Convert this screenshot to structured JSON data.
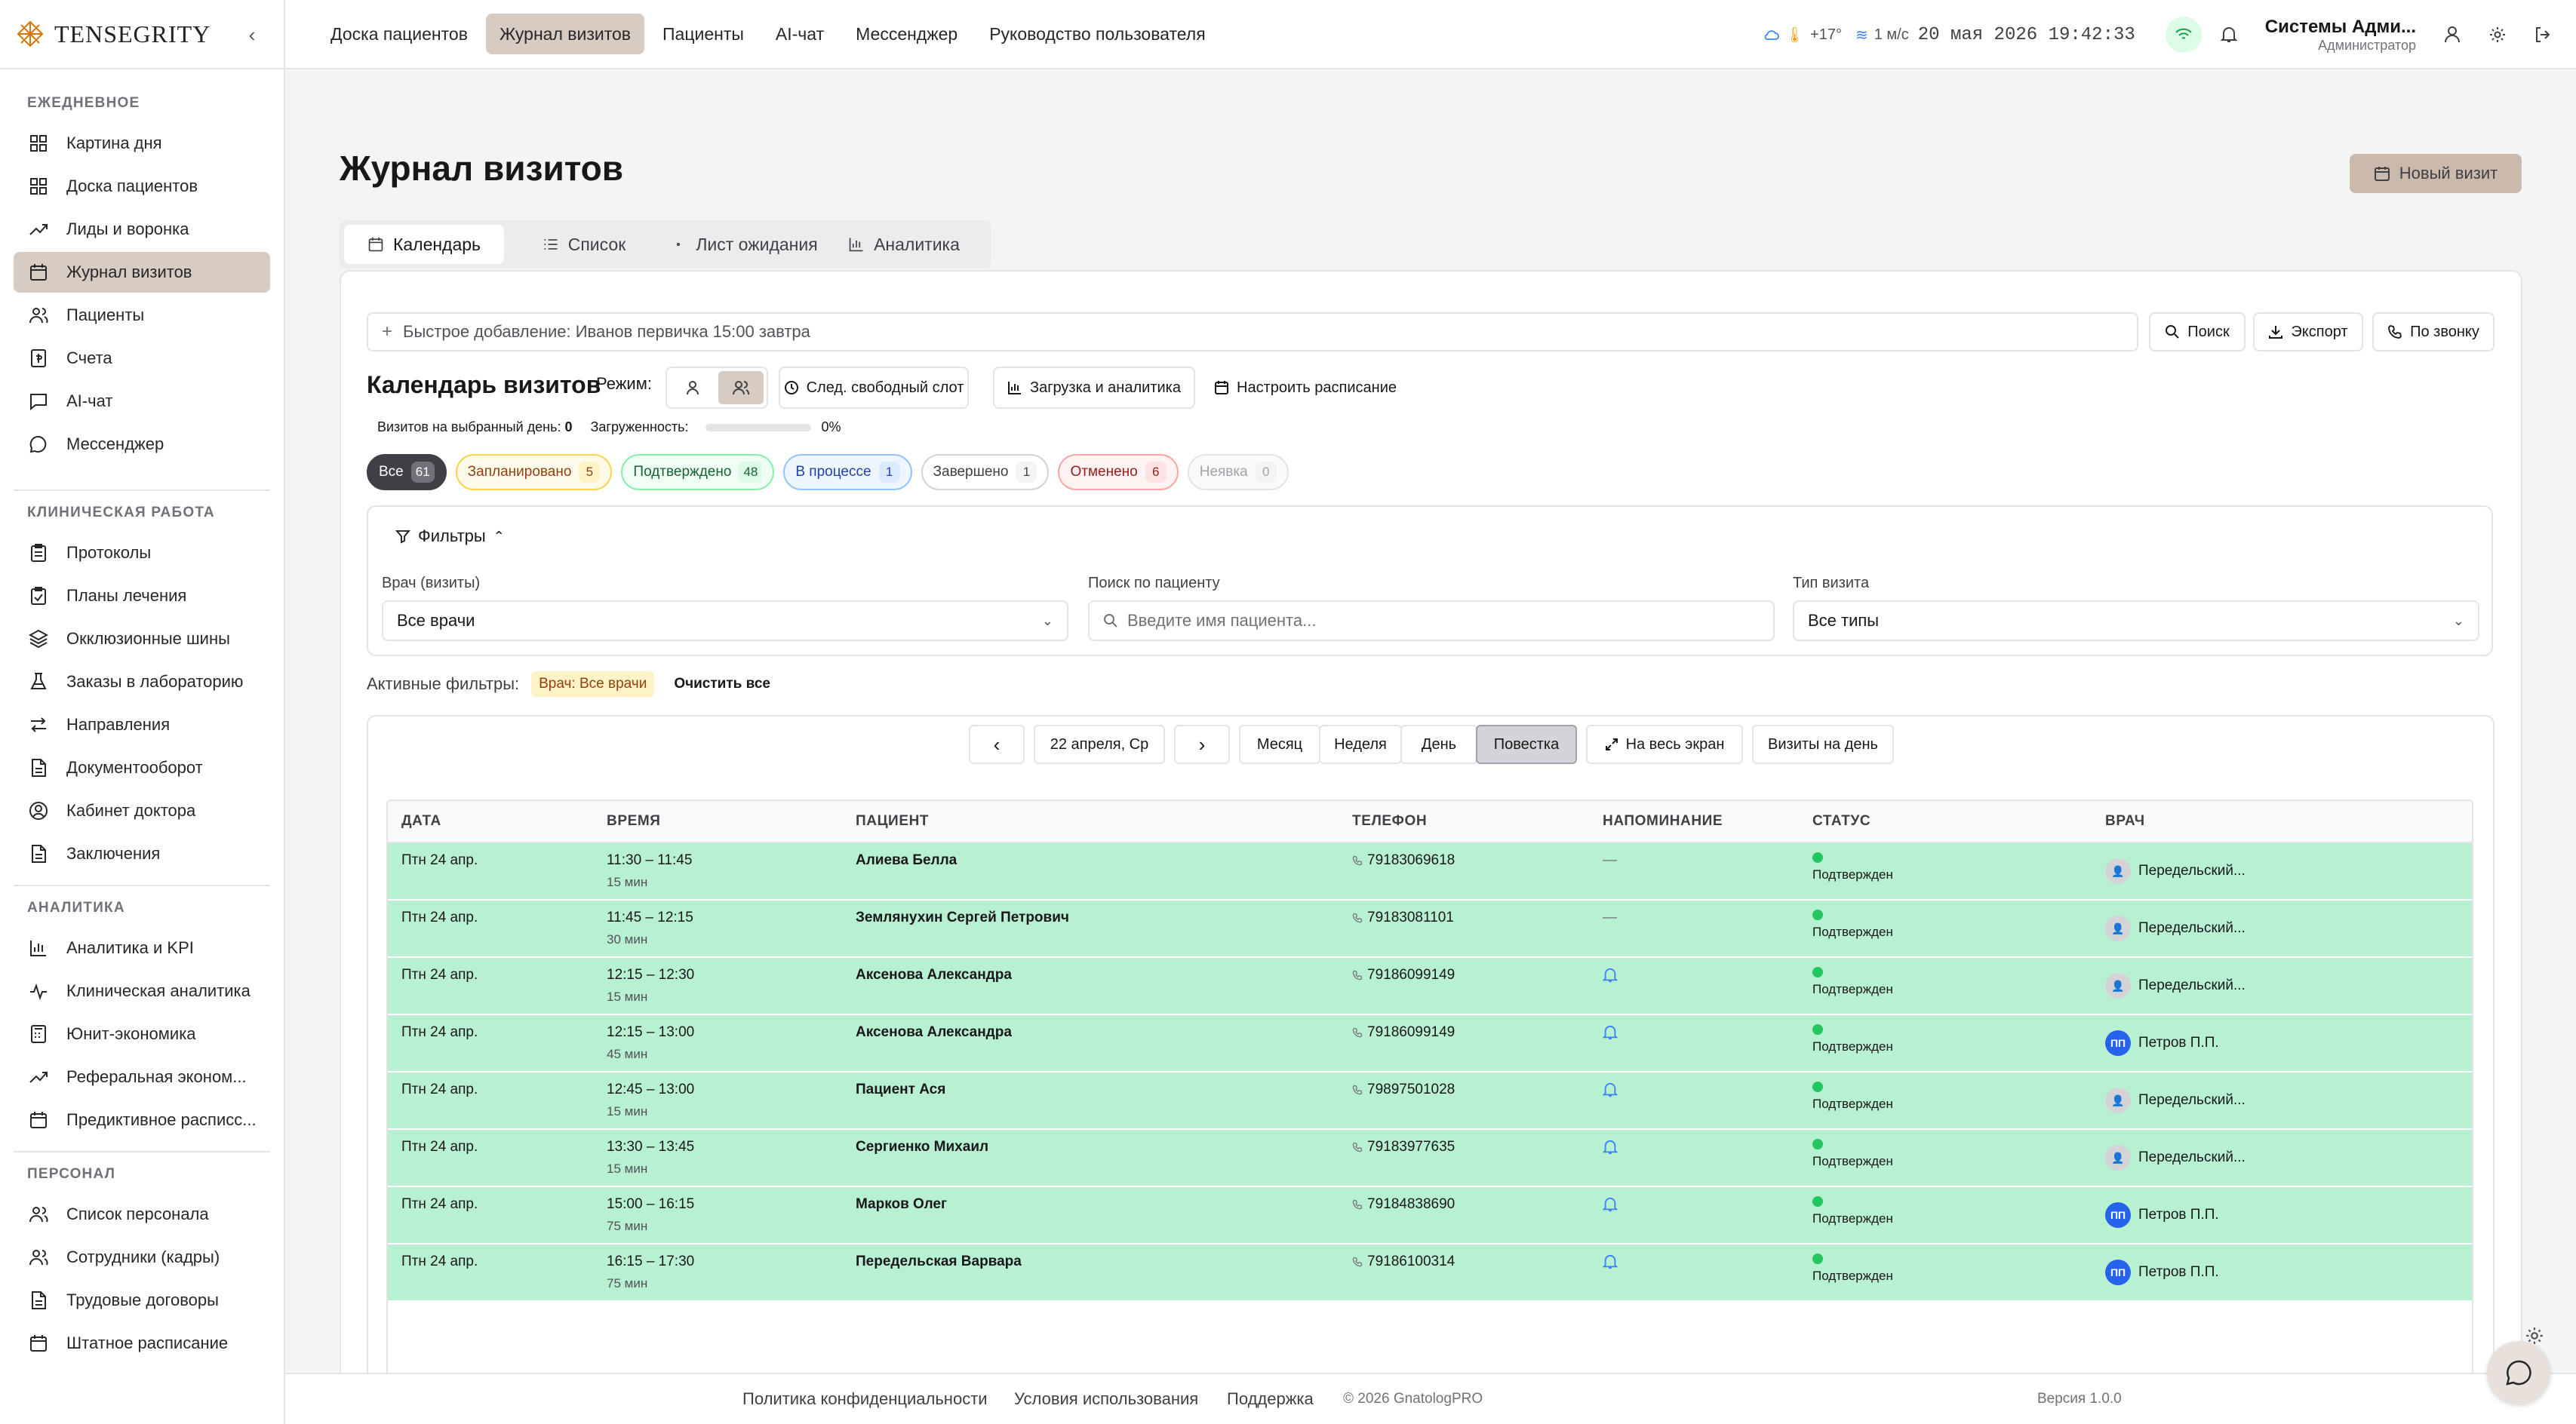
{
  "app": {
    "logo_text": "TENSEGRITY"
  },
  "sidebar": {
    "sections": [
      {
        "title": "ЕЖЕДНЕВНОЕ",
        "items": [
          {
            "label": "Картина дня",
            "icon": "grid-icon"
          },
          {
            "label": "Доска пациентов",
            "icon": "grid-icon"
          },
          {
            "label": "Лиды и воронка",
            "icon": "trend-icon"
          },
          {
            "label": "Журнал визитов",
            "icon": "calendar-icon",
            "active": true
          },
          {
            "label": "Пациенты",
            "icon": "users-icon"
          },
          {
            "label": "Счета",
            "icon": "invoice-icon"
          },
          {
            "label": "AI-чат",
            "icon": "chat-icon"
          },
          {
            "label": "Мессенджер",
            "icon": "message-icon"
          }
        ]
      },
      {
        "title": "КЛИНИЧЕСКАЯ РАБОТА",
        "items": [
          {
            "label": "Протоколы",
            "icon": "clipboard-icon"
          },
          {
            "label": "Планы лечения",
            "icon": "clipboard-check-icon"
          },
          {
            "label": "Окклюзионные шины",
            "icon": "layers-icon"
          },
          {
            "label": "Заказы в лабораторию",
            "icon": "flask-icon"
          },
          {
            "label": "Направления",
            "icon": "arrows-icon"
          },
          {
            "label": "Документооборот",
            "icon": "document-icon"
          },
          {
            "label": "Кабинет доктора",
            "icon": "user-circle-icon"
          },
          {
            "label": "Заключения",
            "icon": "document-icon"
          }
        ]
      },
      {
        "title": "АНАЛИТИКА",
        "items": [
          {
            "label": "Аналитика и KPI",
            "icon": "bar-chart-icon"
          },
          {
            "label": "Клиническая аналитика",
            "icon": "pulse-icon"
          },
          {
            "label": "Юнит-экономика",
            "icon": "calculator-icon"
          },
          {
            "label": "Реферальная эконом...",
            "icon": "trend-icon"
          },
          {
            "label": "Предиктивное расписс...",
            "icon": "calendar-icon"
          }
        ]
      },
      {
        "title": "ПЕРСОНАЛ",
        "items": [
          {
            "label": "Список персонала",
            "icon": "users-icon"
          },
          {
            "label": "Сотрудники (кадры)",
            "icon": "users-icon"
          },
          {
            "label": "Трудовые договоры",
            "icon": "document-icon"
          },
          {
            "label": "Штатное расписание",
            "icon": "calendar-icon"
          }
        ]
      }
    ]
  },
  "topnav": {
    "items": [
      {
        "label": "Доска пациентов"
      },
      {
        "label": "Журнал визитов",
        "active": true
      },
      {
        "label": "Пациенты"
      },
      {
        "label": "AI-чат"
      },
      {
        "label": "Мессенджер"
      },
      {
        "label": "Руководство пользователя"
      }
    ],
    "weather_temp": "+17°",
    "wind": "1 м/с",
    "datetime": "20 мая 2026 19:42:33",
    "user_name": "Системы Адми...",
    "user_role": "Администратор"
  },
  "page": {
    "title": "Журнал визитов",
    "new_visit": "Новый визит"
  },
  "tabs": [
    {
      "label": "Календарь",
      "active": true
    },
    {
      "label": "Список"
    },
    {
      "label": "Лист ожидания"
    },
    {
      "label": "Аналитика"
    }
  ],
  "quick_add": {
    "placeholder": "Быстрое добавление: Иванов первичка 15:00 завтра"
  },
  "actions": {
    "search": "Поиск",
    "export": "Экспорт",
    "by_call": "По звонку"
  },
  "calendar": {
    "title": "Календарь визитов",
    "mode_label": "Режим:",
    "next_slot": "След. свободный слот",
    "load_analytics": "Загрузка и аналитика",
    "schedule": "Настроить расписание",
    "visits_label": "Визитов на выбранный день:",
    "visits_count": "0",
    "load_label": "Загруженность:",
    "load_value": "0%",
    "load_fraction": 0
  },
  "status_chips": [
    {
      "label": "Все",
      "count": "61",
      "style": "dark"
    },
    {
      "label": "Запланировано",
      "count": "5",
      "style": "amber"
    },
    {
      "label": "Подтверждено",
      "count": "48",
      "style": "green"
    },
    {
      "label": "В процессе",
      "count": "1",
      "style": "blue"
    },
    {
      "label": "Завершено",
      "count": "1",
      "style": "gray"
    },
    {
      "label": "Отменено",
      "count": "6",
      "style": "red"
    },
    {
      "label": "Неявка",
      "count": "0",
      "style": "muted"
    }
  ],
  "filters": {
    "title": "Фильтры",
    "doctor_label": "Врач (визиты)",
    "doctor_value": "Все врачи",
    "patient_label": "Поиск по пациенту",
    "patient_placeholder": "Введите имя пациента...",
    "type_label": "Тип визита",
    "type_value": "Все типы",
    "active_label": "Активные фильтры:",
    "active_badge": "Врач: Все врачи",
    "clear_all": "Очистить все"
  },
  "view": {
    "date": "22 апреля, Ср",
    "month": "Месяц",
    "week": "Неделя",
    "day": "День",
    "agenda": "Повестка",
    "fullscreen": "На весь экран",
    "day_visits": "Визиты на день"
  },
  "table": {
    "headers": [
      "ДАТА",
      "ВРЕМЯ",
      "ПАЦИЕНТ",
      "ТЕЛЕФОН",
      "НАПОМИНАНИЕ",
      "СТАТУС",
      "ВРАЧ"
    ],
    "rows": [
      {
        "date": "Птн 24 апр.",
        "time": "11:30 – 11:45",
        "dur": "15 мин",
        "patient": "Алиева Белла",
        "phone": "79183069618",
        "reminder": "—",
        "status": "Подтвержден",
        "doctor": "Передельский...",
        "avatar": "photo"
      },
      {
        "date": "Птн 24 апр.",
        "time": "11:45 – 12:15",
        "dur": "30 мин",
        "patient": "Землянухин Сергей Петрович",
        "phone": "79183081101",
        "reminder": "—",
        "status": "Подтвержден",
        "doctor": "Передельский...",
        "avatar": "photo"
      },
      {
        "date": "Птн 24 апр.",
        "time": "12:15 – 12:30",
        "dur": "15 мин",
        "patient": "Аксенова Александра",
        "phone": "79186099149",
        "reminder": "bell",
        "status": "Подтвержден",
        "doctor": "Передельский...",
        "avatar": "photo"
      },
      {
        "date": "Птн 24 апр.",
        "time": "12:15 – 13:00",
        "dur": "45 мин",
        "patient": "Аксенова Александра",
        "phone": "79186099149",
        "reminder": "bell",
        "status": "Подтвержден",
        "doctor": "Петров П.П.",
        "avatar": "ПП"
      },
      {
        "date": "Птн 24 апр.",
        "time": "12:45 – 13:00",
        "dur": "15 мин",
        "patient": "Пациент Ася",
        "phone": "79897501028",
        "reminder": "bell",
        "status": "Подтвержден",
        "doctor": "Передельский...",
        "avatar": "photo"
      },
      {
        "date": "Птн 24 апр.",
        "time": "13:30 – 13:45",
        "dur": "15 мин",
        "patient": "Сергиенко Михаил",
        "phone": "79183977635",
        "reminder": "bell",
        "status": "Подтвержден",
        "doctor": "Передельский...",
        "avatar": "photo"
      },
      {
        "date": "Птн 24 апр.",
        "time": "15:00 – 16:15",
        "dur": "75 мин",
        "patient": "Марков Олег",
        "phone": "79184838690",
        "reminder": "bell",
        "status": "Подтвержден",
        "doctor": "Петров П.П.",
        "avatar": "ПП"
      },
      {
        "date": "Птн 24 апр.",
        "time": "16:15 – 17:30",
        "dur": "75 мин",
        "patient": "Передельская Варвара",
        "phone": "79186100314",
        "reminder": "bell",
        "status": "Подтвержден",
        "doctor": "Петров П.П.",
        "avatar": "ПП"
      }
    ]
  },
  "footer": {
    "privacy": "Политика конфиденциальности",
    "terms": "Условия использования",
    "support": "Поддержка",
    "copyright": "© 2026 GnatologPRO",
    "version": "Версия 1.0.0"
  },
  "colors": {
    "accent": "#d8cbc1",
    "row_confirmed": "#b8f0d2",
    "status_dot": "#22c55e"
  }
}
